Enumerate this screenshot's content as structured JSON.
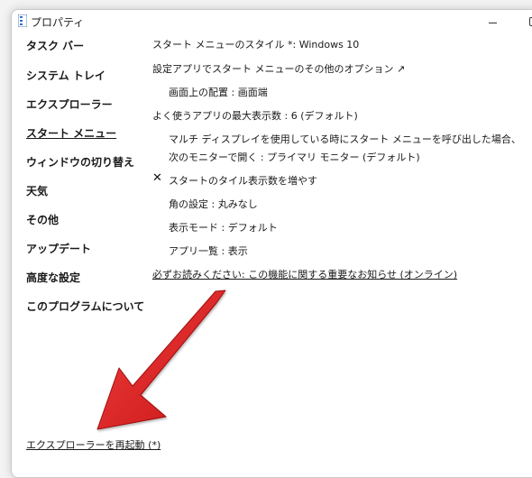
{
  "window": {
    "title": "プロパティ"
  },
  "nav": {
    "items": [
      {
        "label": "タスク バー"
      },
      {
        "label": "システム トレイ"
      },
      {
        "label": "エクスプローラー"
      },
      {
        "label": "スタート メニュー"
      },
      {
        "label": "ウィンドウの切り替え"
      },
      {
        "label": "天気"
      },
      {
        "label": "その他"
      },
      {
        "label": "アップデート"
      },
      {
        "label": "高度な設定"
      },
      {
        "label": "このプログラムについて"
      }
    ],
    "active": "スタート メニュー"
  },
  "options": {
    "start_style": "スタート メニューのスタイル *: Windows 10",
    "settings_link": "設定アプリでスタート メニューのその他のオプション ↗",
    "position": "画面上の配置 : 画面端",
    "max_apps": "よく使うアプリの最大表示数 : 6 (デフォルト)",
    "multi_display_line1": "マルチ ディスプレイを使用している時にスタート メニューを呼び出した場合、",
    "multi_display_line2": "次のモニターで開く : プライマリ モニター (デフォルト)",
    "tile_count_mark": "✕",
    "tile_count": "スタートのタイル表示数を増やす",
    "corner": "角の設定 : 丸みなし",
    "display_mode": "表示モード : デフォルト",
    "app_list": "アプリ一覧 : 表示",
    "notice_link": "必ずお読みください: この機能に関する重要なお知らせ (オンライン)"
  },
  "footer": {
    "restart_link": "エクスプローラーを再起動 (*)"
  },
  "colors": {
    "arrow": "#e02626"
  }
}
